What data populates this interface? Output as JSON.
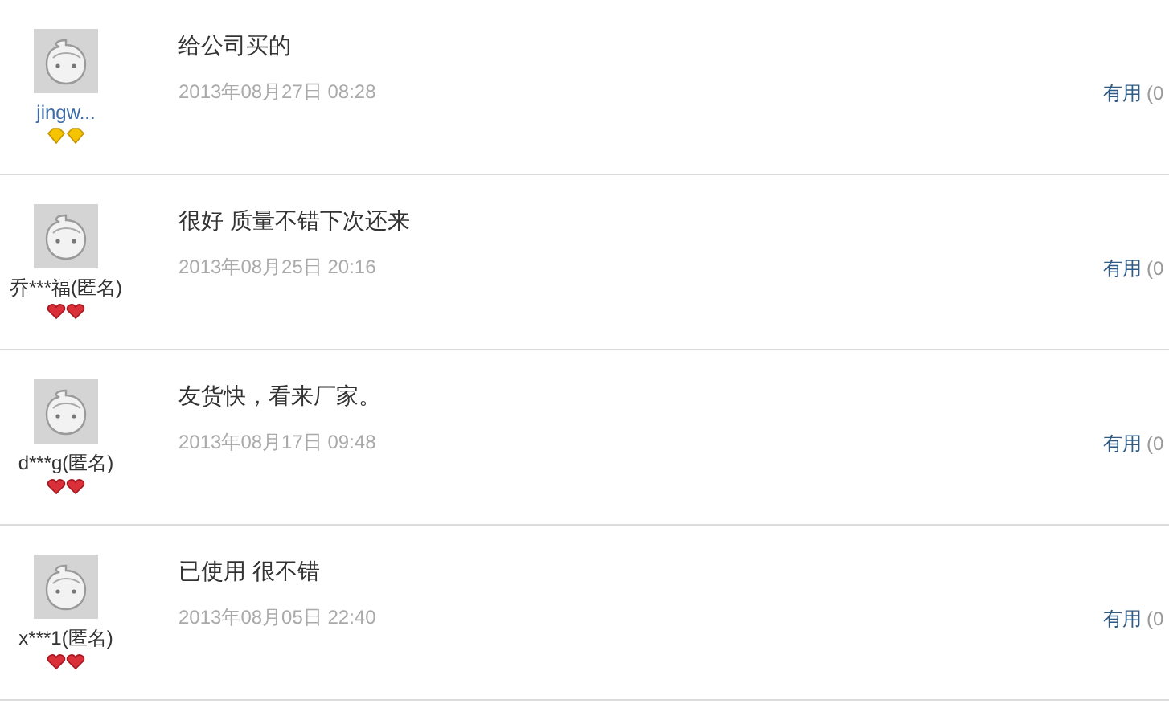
{
  "reviews": [
    {
      "user": {
        "name": "jingw...",
        "link": true,
        "rank": {
          "kind": "diamond"
        }
      },
      "comment": "给公司买的",
      "date": "2013年08月27日 08:28",
      "useful": {
        "label": "有用",
        "count": "(0"
      }
    },
    {
      "user": {
        "name": "乔***福(匿名)",
        "link": false,
        "rank": {
          "kind": "heart"
        }
      },
      "comment": "很好 质量不错下次还来",
      "date": "2013年08月25日 20:16",
      "useful": {
        "label": "有用",
        "count": "(0"
      }
    },
    {
      "user": {
        "name": "d***g(匿名)",
        "link": false,
        "rank": {
          "kind": "heart"
        }
      },
      "comment": "友货快，看来厂家。",
      "date": "2013年08月17日 09:48",
      "useful": {
        "label": "有用",
        "count": "(0"
      }
    },
    {
      "user": {
        "name": "x***1(匿名)",
        "link": false,
        "rank": {
          "kind": "heart"
        }
      },
      "comment": "已使用 很不错",
      "date": "2013年08月05日 22:40",
      "useful": {
        "label": "有用",
        "count": "(0"
      }
    }
  ]
}
